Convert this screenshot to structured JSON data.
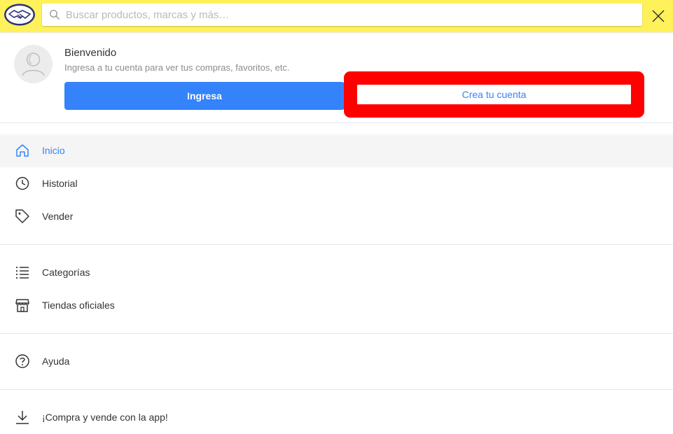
{
  "header": {
    "logo_name": "mercadolibre-handshake-logo",
    "search": {
      "placeholder": "Buscar productos, marcas y más…",
      "value": ""
    },
    "close_icon": "close-icon",
    "colors": {
      "bar": "#fff159"
    }
  },
  "account": {
    "title": "Bienvenido",
    "subtitle": "Ingresa a tu cuenta para ver tus compras, favoritos, etc.",
    "login_label": "Ingresa",
    "register_label": "Crea tu cuenta",
    "colors": {
      "primary": "#3483fa",
      "highlight": "#ff0000"
    }
  },
  "menu": {
    "inicio": {
      "label": "Inicio",
      "icon": "home-icon",
      "active": true
    },
    "historial": {
      "label": "Historial",
      "icon": "clock-icon"
    },
    "vender": {
      "label": "Vender",
      "icon": "tag-icon"
    },
    "categorias": {
      "label": "Categorías",
      "icon": "list-icon"
    },
    "tiendas": {
      "label": "Tiendas oficiales",
      "icon": "store-icon"
    },
    "ayuda": {
      "label": "Ayuda",
      "icon": "help-icon"
    },
    "app": {
      "label": "¡Compra y vende con la app!",
      "icon": "download-icon"
    }
  }
}
